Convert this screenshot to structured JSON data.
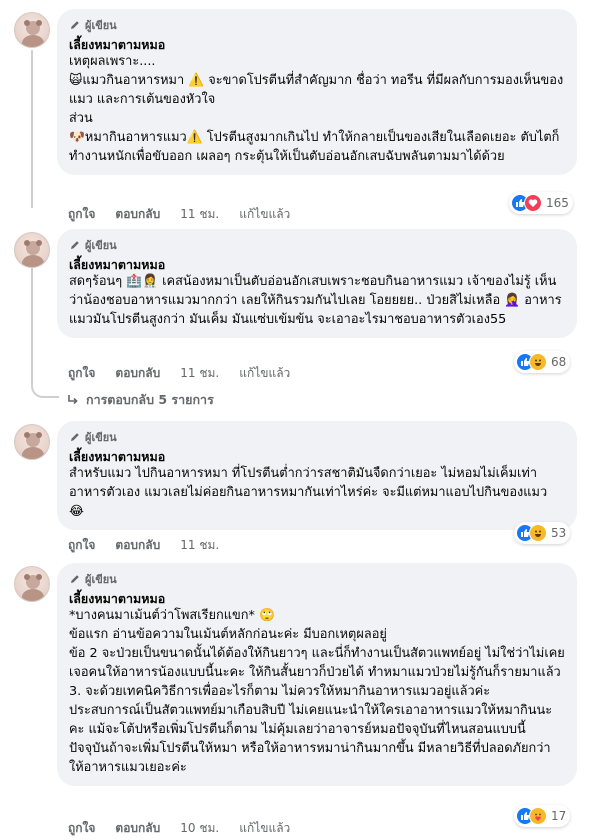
{
  "author_badge": "ผู้เขียน",
  "author_name": "เลี้ยงหมาตามหมอ",
  "comments": [
    {
      "text": "เหตุผลเพราะ....\n🙀แมวกินอาหารหมา ⚠️ จะขาดโปรตีนที่สำคัญมาก ชื่อว่า ทอรีน ที่มีผลกับการมองเห็นของแมว และการเต้นของหัวใจ\nส่วน\n🐶หมากินอาหารแมว⚠️ โปรตีนสูงมากเกินไป ทำให้กลายเป็นของเสียในเลือดเยอะ ตับไตก็ทำงานหนักเพื่อขับออก เผลอๆ กระตุ้นให้เป็นตับอ่อนอักเสบฉับพลันตามมาได้ด้วย",
      "like": "ถูกใจ",
      "reply": "ตอบกลับ",
      "time": "11 ชม.",
      "edited": "แก้ไขแล้ว",
      "react_count": "165"
    },
    {
      "text": "สดๆร้อนๆ 🏥👩‍⚕️ เคสน้องหมาเป็นตับอ่อนอักเสบเพราะชอบกินอาหารแมว เจ้าของไม่รู้ เห็นว่าน้องชอบอาหารแมวมากกว่า เลยให้กินรวมกันไปเลย โอยยยย.. ป่วยสิไม่เหลือ 🤦‍♀️ อาหารแมวมันโปรตีนสูงกว่า มันเค็ม มันแซ่บเข้มข้น จะเอาอะไรมาชอบอาหารตัวเอง55",
      "like": "ถูกใจ",
      "reply": "ตอบกลับ",
      "time": "11 ชม.",
      "edited": "แก้ไขแล้ว",
      "react_count": "68",
      "replies_label": "การตอบกลับ 5 รายการ"
    },
    {
      "text": "สำหรับแมว ไปกินอาหารหมา ที่โปรตีนต่ำกว่ารสชาติมันจืดกว่าเยอะ ไม่หอมไม่เค็มเท่าอาหารตัวเอง แมวเลยไม่ค่อยกินอาหารหมากันเท่าไหร่ค่ะ จะมีแต่หมาแอบไปกินของแมว 😂",
      "like": "ถูกใจ",
      "reply": "ตอบกลับ",
      "time": "11 ชม.",
      "react_count": "53"
    },
    {
      "text": "*บางคนมาเม้นต์ว่าโพสเรียกแขก* 🙄\nข้อแรก อ่านข้อความในเม้นต์หลักก่อนะค่ะ มีบอกเหตุผลอยู่\nข้อ 2 จะป่วยเป็นขนาดนั้นได้ต้องให้กินยาวๆ และนี่ก็ทำงานเป็นสัตวแพทย์อยู่ ไม่ใช่ว่าไม่เคยเจอคนให้อาหารน้องแบบนี้นะคะ ให้กินสั้นยาวก็ป่วยได้ ทำหมาแมวป่วยไม่รู้กันก็รายมาแล้ว\n3. จะด้วยเทคนิควิธีการเพื่ออะไรก็ตาม ไม่ควรให้หมากินอาหารแมวอยู่แล้วค่ะ ประสบการณ์เป็นสัตวแพทย์มาเกือบสิบปี ไม่เคยแนะนำให้ใครเอาอาหารแมวให้หมากินนะคะ แม้จะโต้ปหรือเพิ่มโปรตีนก็ตาม ไม่คุ้มเลยว่าอาจารย์หมอปัจจุบันที่ไหนสอนแบบนี้ ปัจจุบันถ้าจะเพิ่มโปรตีนให้หมา หรือให้อาหารหมาน่ากินมากขึ้น มีหลายวิธีที่ปลอดภัยกว่าให้อาหารแมวเยอะค่ะ",
      "like": "ถูกใจ",
      "reply": "ตอบกลับ",
      "time": "10 ชม.",
      "edited": "แก้ไขแล้ว",
      "react_count": "17"
    }
  ],
  "colors": {
    "bubble": "#f0f2f5",
    "meta_text": "#65676b",
    "like_blue": "#1877f2",
    "love_red": "#f33e58",
    "haha_yellow": "#f7b928"
  },
  "icons": [
    "pencil-icon",
    "like-icon",
    "love-icon",
    "haha-icon",
    "care-icon",
    "reply-arrow-icon",
    "avatar"
  ]
}
